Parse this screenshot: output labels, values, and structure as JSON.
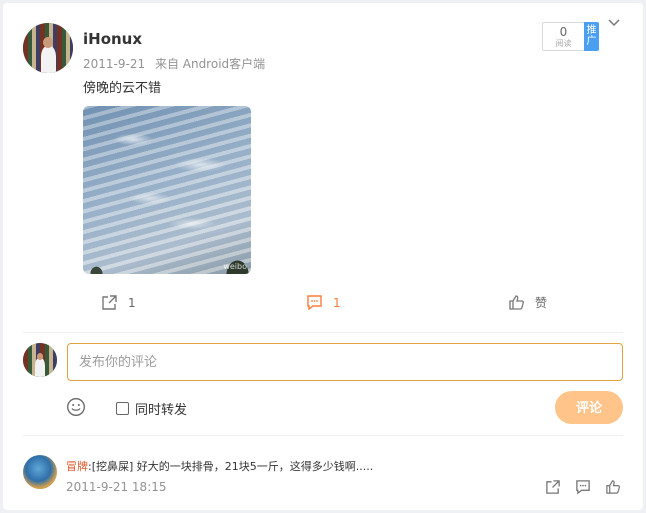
{
  "post": {
    "username": "iHonux",
    "date": "2011-9-21",
    "source": "来自 Android客户端",
    "text": "傍晚的云不错",
    "read_count": "0",
    "read_label": "阅读",
    "promote_label": "推广",
    "image_watermark": "weibo"
  },
  "actions": {
    "repost_count": "1",
    "comment_count": "1",
    "like_label": "赞"
  },
  "composer": {
    "placeholder": "发布你的评论",
    "repost_label": "同时转发",
    "submit_label": "评论"
  },
  "comments": [
    {
      "author": "冒牌",
      "text": ":[挖鼻屎] 好大的一块排骨，21块5一斤，这得多少钱啊.....",
      "time": "2011-9-21 18:15"
    }
  ],
  "colors": {
    "accent": "#fa7d3c",
    "submit_bg": "#ffc48a",
    "promote_bg": "#4b9ff0",
    "input_border": "#e2a23e"
  }
}
